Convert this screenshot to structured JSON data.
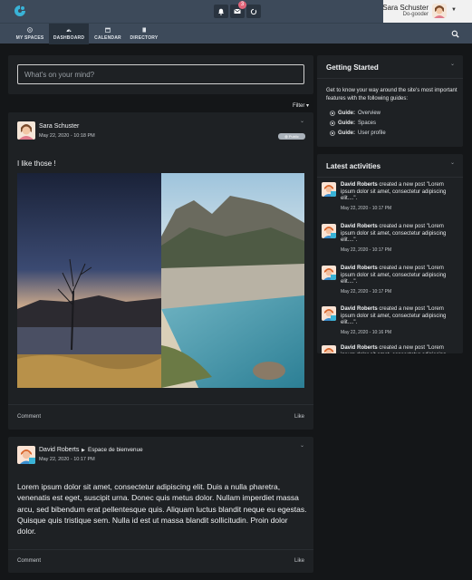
{
  "topbar": {
    "notifications_count": "3",
    "user": {
      "name": "Sara Schuster",
      "subtitle": "Do-gooder"
    }
  },
  "nav": {
    "items": [
      {
        "label": "MY SPACES"
      },
      {
        "label": "DASHBOARD"
      },
      {
        "label": "CALENDAR"
      },
      {
        "label": "DIRECTORY"
      }
    ],
    "active": "DASHBOARD"
  },
  "composer": {
    "placeholder": "What's on your mind?"
  },
  "stream": {
    "filter_label": "Filter",
    "posts": [
      {
        "author": "Sara Schuster",
        "date": "May 22, 2020 - 10:18 PM",
        "visibility": "Public",
        "text": "I like those !",
        "footer_left": "Comment",
        "footer_right": "Like"
      },
      {
        "author": "David Roberts",
        "space": "Espace de bienvenue",
        "date": "May 22, 2020 - 10:17 PM",
        "text": "Lorem ipsum dolor sit amet, consectetur adipiscing elit. Duis a nulla pharetra, venenatis est eget, suscipit urna. Donec quis metus dolor. Nullam imperdiet massa arcu, sed bibendum erat pellentesque quis. Aliquam luctus blandit neque eu egestas. Quisque quis tristique sem. Nulla id est ut massa blandit sollicitudin. Proin dolor dolor.",
        "footer_left": "Comment",
        "footer_right": "Like"
      }
    ]
  },
  "getting_started": {
    "title": "Getting Started",
    "intro": "Get to know your way around the site's most important features with the following guides:",
    "guides": [
      {
        "prefix": "Guide:",
        "label": "Overview"
      },
      {
        "prefix": "Guide:",
        "label": "Spaces"
      },
      {
        "prefix": "Guide:",
        "label": "User profile"
      }
    ]
  },
  "latest_activities": {
    "title": "Latest activities",
    "items": [
      {
        "actor": "David Roberts",
        "text": " created a new post \"Lorem ipsum dolor sit amet, consectetur adipiscing elit....\".",
        "date": "May 22, 2020 - 10:17 PM"
      },
      {
        "actor": "David Roberts",
        "text": " created a new post \"Lorem ipsum dolor sit amet, consectetur adipiscing elit....\".",
        "date": "May 22, 2020 - 10:17 PM"
      },
      {
        "actor": "David Roberts",
        "text": " created a new post \"Lorem ipsum dolor sit amet, consectetur adipiscing elit....\".",
        "date": "May 22, 2020 - 10:17 PM"
      },
      {
        "actor": "David Roberts",
        "text": " created a new post \"Lorem ipsum dolor sit amet, consectetur adipiscing elit....\".",
        "date": "May 22, 2020 - 10:16 PM"
      },
      {
        "actor": "David Roberts",
        "text": " created a new post \"Lorem ipsum dolor sit amet, consectetur adipiscing elit....\".",
        "date": ""
      }
    ]
  },
  "colors": {
    "header_bg": "#3d4a5a",
    "page_bg": "#141618",
    "card_bg": "#1e2124",
    "badge": "#e0657a",
    "logo": "#39b3d7"
  }
}
